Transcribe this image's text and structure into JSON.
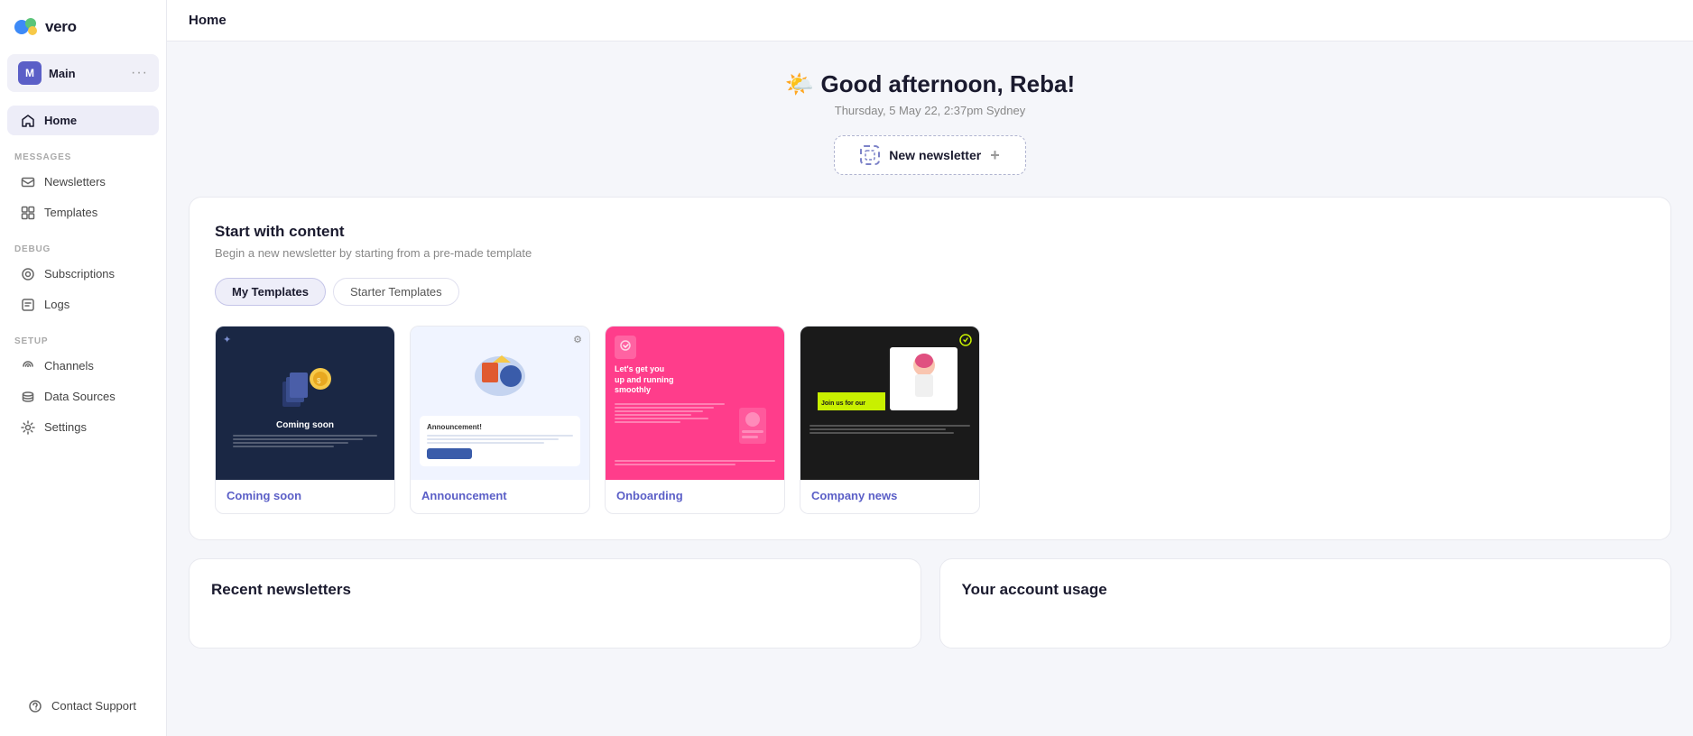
{
  "app": {
    "logo_text": "vero",
    "workspace": {
      "avatar_letter": "M",
      "name": "Main"
    }
  },
  "sidebar": {
    "sections": [
      {
        "label": "",
        "items": [
          {
            "id": "home",
            "label": "Home",
            "icon": "home-icon",
            "active": true
          }
        ]
      },
      {
        "label": "MESSAGES",
        "items": [
          {
            "id": "newsletters",
            "label": "Newsletters",
            "icon": "newsletter-icon",
            "active": false
          },
          {
            "id": "templates",
            "label": "Templates",
            "icon": "templates-icon",
            "active": false
          }
        ]
      },
      {
        "label": "DEBUG",
        "items": [
          {
            "id": "subscriptions",
            "label": "Subscriptions",
            "icon": "subscriptions-icon",
            "active": false
          },
          {
            "id": "logs",
            "label": "Logs",
            "icon": "logs-icon",
            "active": false
          }
        ]
      },
      {
        "label": "SETUP",
        "items": [
          {
            "id": "channels",
            "label": "Channels",
            "icon": "channels-icon",
            "active": false
          },
          {
            "id": "data-sources",
            "label": "Data Sources",
            "icon": "data-sources-icon",
            "active": false
          },
          {
            "id": "settings",
            "label": "Settings",
            "icon": "settings-icon",
            "active": false
          }
        ]
      }
    ],
    "bottom": {
      "contact_support_label": "Contact Support"
    }
  },
  "topbar": {
    "title": "Home"
  },
  "hero": {
    "greeting": "Good afternoon, Reba!",
    "greeting_emoji": "🌤️",
    "date": "Thursday, 5 May 22, 2:37pm Sydney",
    "new_newsletter_label": "New newsletter",
    "new_newsletter_plus": "+"
  },
  "templates_section": {
    "title": "Start with content",
    "subtitle": "Begin a new newsletter by starting from a pre-made template",
    "tabs": [
      {
        "id": "my-templates",
        "label": "My Templates",
        "active": true
      },
      {
        "id": "starter-templates",
        "label": "Starter Templates",
        "active": false
      }
    ],
    "templates": [
      {
        "id": "coming-soon",
        "label": "Coming soon",
        "style": "dark"
      },
      {
        "id": "announcement",
        "label": "Announcement",
        "style": "light"
      },
      {
        "id": "onboarding",
        "label": "Onboarding",
        "style": "pink"
      },
      {
        "id": "company-news",
        "label": "Company news",
        "style": "black"
      }
    ]
  },
  "bottom_sections": {
    "recent_newsletters": {
      "title": "Recent newsletters"
    },
    "account_usage": {
      "title": "Your account usage"
    }
  }
}
